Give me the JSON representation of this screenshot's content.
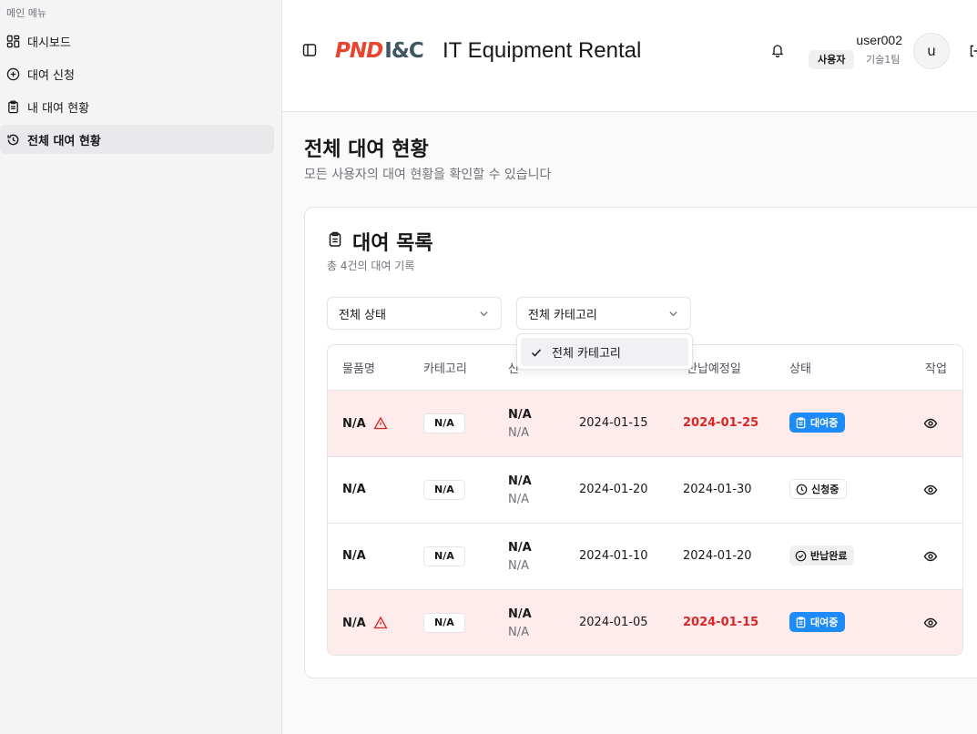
{
  "sidebar": {
    "group_label": "메인 메뉴",
    "items": [
      {
        "label": "대시보드",
        "icon": "dashboard-icon"
      },
      {
        "label": "대여 신청",
        "icon": "plus-circle-icon"
      },
      {
        "label": "내 대여 현황",
        "icon": "clipboard-icon"
      },
      {
        "label": "전체 대여 현황",
        "icon": "history-icon",
        "active": true
      }
    ]
  },
  "header": {
    "logo_part1": "PND",
    "logo_part2": "I&C",
    "title": "IT Equipment Rental",
    "username": "user002",
    "role": "사용자",
    "team": "기술1팀",
    "avatar_initial": "u"
  },
  "page": {
    "title": "전체 대여 현황",
    "subtitle": "모든 사용자의 대여 현황을 확인할 수 있습니다"
  },
  "card": {
    "title": "대여 목록",
    "description": "총 4건의 대여 기록"
  },
  "filters": {
    "status_value": "전체 상태",
    "category_value": "전체 카테고리",
    "category_options": [
      "전체 카테고리"
    ]
  },
  "table": {
    "headers": [
      "물품명",
      "카테고리",
      "신",
      "",
      "반납예정일",
      "상태",
      "작업"
    ],
    "rows": [
      {
        "name": "N/A",
        "category": "N/A",
        "applicant": "N/A",
        "applicant_sub": "N/A",
        "start": "2024-01-15",
        "due": "2024-01-25",
        "status": "대여중",
        "overdue": true
      },
      {
        "name": "N/A",
        "category": "N/A",
        "applicant": "N/A",
        "applicant_sub": "N/A",
        "start": "2024-01-20",
        "due": "2024-01-30",
        "status": "신청중",
        "overdue": false
      },
      {
        "name": "N/A",
        "category": "N/A",
        "applicant": "N/A",
        "applicant_sub": "N/A",
        "start": "2024-01-10",
        "due": "2024-01-20",
        "status": "반납완료",
        "overdue": false
      },
      {
        "name": "N/A",
        "category": "N/A",
        "applicant": "N/A",
        "applicant_sub": "N/A",
        "start": "2024-01-05",
        "due": "2024-01-15",
        "status": "대여중",
        "overdue": true
      }
    ]
  },
  "colors": {
    "accent_blue": "#1d8cf8",
    "overdue_red": "#dc2626",
    "overdue_row_bg": "#fdeceb",
    "logo_red": "#e8432f",
    "logo_slate": "#3f5663"
  }
}
